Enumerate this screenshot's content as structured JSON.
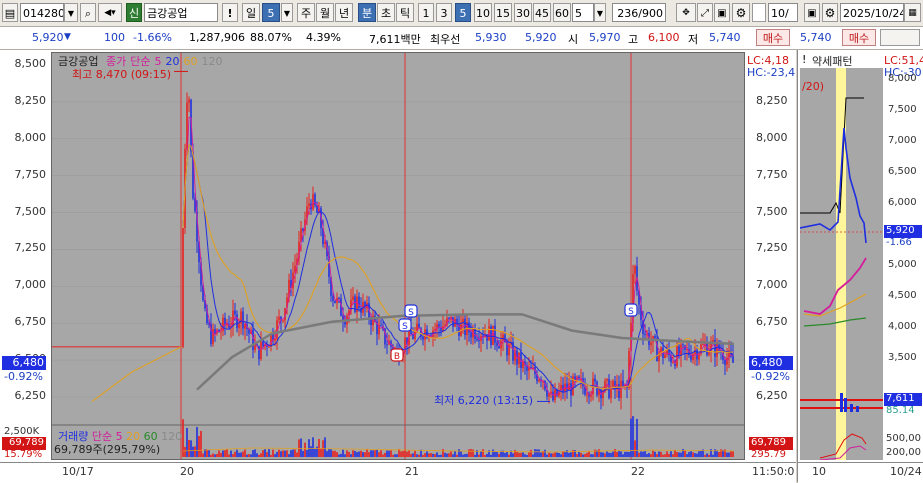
{
  "toolbar": {
    "code": "014280",
    "company_badge": "신",
    "company_name": "금강공업",
    "period_day": "일",
    "period_num": "5",
    "week": "주",
    "month": "월",
    "year": "년",
    "minute": "분",
    "sec": "초",
    "tick": "틱",
    "intervals": [
      "1",
      "3",
      "5",
      "10",
      "15",
      "30",
      "45",
      "60"
    ],
    "active_interval": "5",
    "count_select": "5",
    "count_range": "236/900",
    "right_code": "10/",
    "date": "2025/10/24"
  },
  "infobar": {
    "price": "5,920",
    "change": "100",
    "change_pct": "-1.66%",
    "volume": "1,287,906",
    "vol_ratio": "88.07%",
    "turnover_pct": "4.39%",
    "amount": "7,611백만",
    "pref_label": "최우선",
    "ask": "5,930",
    "bid": "5,920",
    "open_label": "시",
    "open": "5,970",
    "high_label": "고",
    "high": "6,100",
    "low_label": "저",
    "low": "5,740",
    "buy_label": "매수",
    "right_price": "5,740",
    "right_buy_label": "매수"
  },
  "chart_main": {
    "stock_label": "금강공업",
    "legend": [
      {
        "name": "종가",
        "color": "#d41d9c"
      },
      {
        "name": "단순",
        "color": "#d41d9c"
      },
      {
        "name": "5",
        "color": "#d41d9c"
      },
      {
        "name": "20",
        "color": "#1f2ee0"
      },
      {
        "name": "60",
        "color": "#e0a020"
      },
      {
        "name": "120",
        "color": "#8a8a8a"
      }
    ],
    "high_note": "최고 8,470 (09:15)",
    "low_note": "최저 6,220 (13:15)",
    "lc_note": "LC:4,18",
    "hc_note": "HC:-23,4",
    "left_ticks": [
      "8,500",
      "8,250",
      "8,000",
      "7,750",
      "7,500",
      "7,250",
      "7,000",
      "6,750",
      "6,500",
      "6,250"
    ],
    "right_ticks": [
      "8,250",
      "8,000",
      "7,750",
      "7,500",
      "7,250",
      "7,000",
      "6,750",
      "6,250"
    ],
    "cur_price_left": "6,480",
    "cur_pct_left": "-0.92%",
    "cur_price_right": "6,480",
    "cur_pct_right": "-0.92%"
  },
  "chart_vol": {
    "legend_vol": "거래량",
    "legend_ma": "단순",
    "ma_periods": [
      "5",
      "20",
      "60",
      "120"
    ],
    "vol_text": "69,789주(295,79%)",
    "y_tick": "2,500K",
    "vol_left": "69,789",
    "vol_pct_left": "15.79%",
    "vol_right": "69,789",
    "vol_pct_right": "295.79"
  },
  "xaxis": {
    "labels": [
      "10/17",
      "20",
      "21",
      "22"
    ],
    "time": "11:50:0"
  },
  "right_pane": {
    "title": "약세패턴",
    "prefix": "!",
    "note": "/20)",
    "lc": "LC:51,4",
    "hc": "HC:-30",
    "ticks": [
      "8,000",
      "7,500",
      "7,000",
      "6,500",
      "6,000",
      "5,500",
      "5,000",
      "4,500",
      "4,000",
      "3,500"
    ],
    "cur_price": "5,920",
    "cur_pct": "-1.66",
    "vol_price": "7,611",
    "vol_sub": "85.14",
    "vol_ticks": [
      "500,00",
      "200,00"
    ],
    "x_left": "10",
    "x_right": "10/24"
  },
  "colors": {
    "up": "#e8201e",
    "down": "#1f2ee0",
    "chart_bg": "#a7a7a7",
    "accent": "#3d6fb3"
  }
}
